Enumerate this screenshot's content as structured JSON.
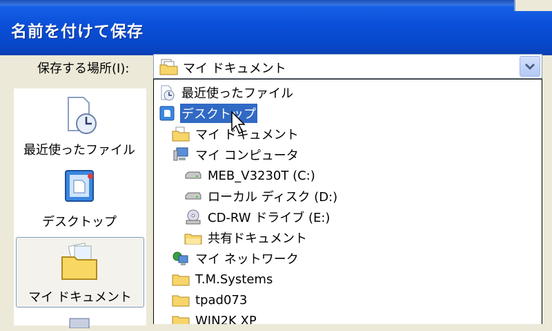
{
  "window": {
    "title": "名前を付けて保存"
  },
  "save_in": {
    "label": "保存する場所(I):",
    "value": "マイ ドキュメント"
  },
  "places": [
    {
      "label": "最近使ったファイル",
      "icon": "recent-documents-icon"
    },
    {
      "label": "デスクトップ",
      "icon": "desktop-icon"
    },
    {
      "label": "マイ ドキュメント",
      "icon": "my-documents-folder-icon",
      "selected": true
    }
  ],
  "dropdown": {
    "items": [
      {
        "label": "最近使ったファイル",
        "icon": "recent-documents-icon",
        "indent": 0
      },
      {
        "label": "デスクトップ",
        "icon": "desktop-icon",
        "indent": 0,
        "highlighted": true
      },
      {
        "label": "マイ ドキュメント",
        "icon": "folder-icon",
        "indent": 1
      },
      {
        "label": "マイ コンピュータ",
        "icon": "computer-icon",
        "indent": 1
      },
      {
        "label": "MEB_V3230T (C:)",
        "icon": "hard-drive-icon",
        "indent": 2
      },
      {
        "label": "ローカル ディスク (D:)",
        "icon": "hard-drive-icon",
        "indent": 2
      },
      {
        "label": "CD-RW ドライブ (E:)",
        "icon": "cd-drive-icon",
        "indent": 2
      },
      {
        "label": "共有ドキュメント",
        "icon": "shared-folder-icon",
        "indent": 2
      },
      {
        "label": "マイ ネットワーク",
        "icon": "network-icon",
        "indent": 1
      },
      {
        "label": "T.M.Systems",
        "icon": "folder-icon",
        "indent": 1
      },
      {
        "label": "tpad073",
        "icon": "folder-icon",
        "indent": 1
      },
      {
        "label": "WIN2K XP",
        "icon": "folder-icon",
        "indent": 1
      }
    ]
  },
  "colors": {
    "title_bar": "#0a4fd9",
    "selection": "#316ac5",
    "dialog_bg": "#ece9d8"
  }
}
